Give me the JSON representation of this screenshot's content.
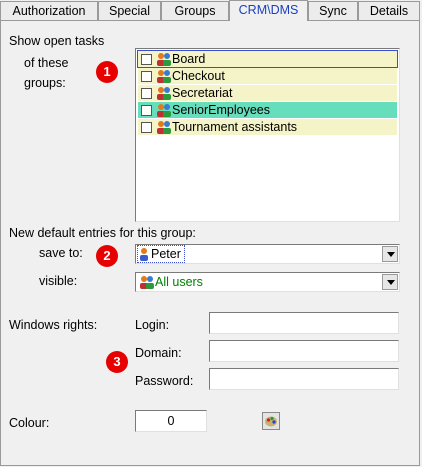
{
  "tabs": [
    {
      "label": "Authorization",
      "active": false
    },
    {
      "label": "Special",
      "active": false
    },
    {
      "label": "Groups",
      "active": false
    },
    {
      "label": "CRM\\DMS",
      "active": true
    },
    {
      "label": "Sync",
      "active": false
    },
    {
      "label": "Details",
      "active": false
    }
  ],
  "open_tasks": {
    "label_line1": "Show open tasks",
    "label_line2": "of these",
    "label_line3": "groups:",
    "groups": [
      {
        "name": "Board",
        "checked": false,
        "selected": true
      },
      {
        "name": "Checkout",
        "checked": false,
        "selected": false
      },
      {
        "name": "Secretariat",
        "checked": false,
        "selected": false
      },
      {
        "name": "SeniorEmployees",
        "checked": false,
        "selected": false,
        "highlight": true
      },
      {
        "name": "Tournament assistants",
        "checked": false,
        "selected": false
      }
    ]
  },
  "badges": {
    "one": "1",
    "two": "2",
    "three": "3"
  },
  "defaults": {
    "heading": "New default entries for this group:",
    "save_to_label": "save to:",
    "save_to_value": "Peter",
    "visible_label": "visible:",
    "visible_value": "All users"
  },
  "windows_rights": {
    "label": "Windows rights:",
    "login_label": "Login:",
    "login_value": "",
    "domain_label": "Domain:",
    "domain_value": "",
    "password_label": "Password:",
    "password_value": ""
  },
  "colour": {
    "label": "Colour:",
    "value": "0",
    "picker_icon": "color-palette-icon"
  },
  "colors": {
    "row_tint": "#f5f3c8",
    "row_highlight": "#66ddbb",
    "active_tab_text": "#1a3fbf",
    "visible_value_text": "#008000",
    "badge": "#e60000"
  }
}
